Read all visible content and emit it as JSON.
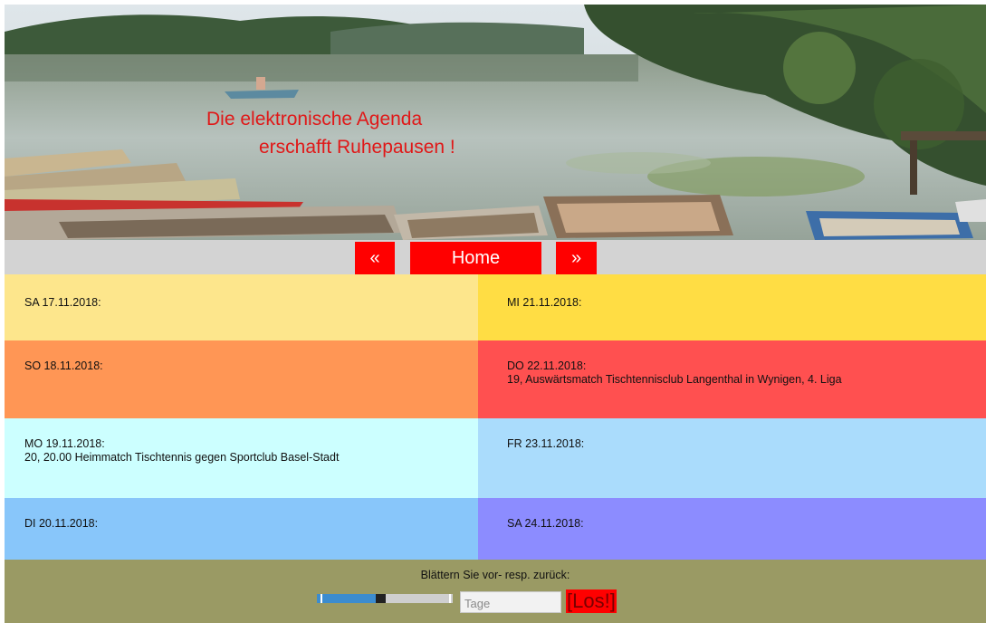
{
  "banner": {
    "slogan_line1": "Die elektronische Agenda",
    "slogan_line2": "erschafft Ruhepausen !"
  },
  "nav": {
    "prev_label": "«",
    "home_label": "Home",
    "next_label": "»"
  },
  "agenda": {
    "left": [
      {
        "date": "SA 17.11.2018:",
        "event": "",
        "color": "#fde68c"
      },
      {
        "date": "SO 18.11.2018:",
        "event": "",
        "color": "#ff9655"
      },
      {
        "date": "MO 19.11.2018:",
        "event": "20, 20.00 Heimmatch Tischtennis gegen Sportclub Basel-Stadt",
        "color": "#ccffff"
      },
      {
        "date": "DI 20.11.2018:",
        "event": "",
        "color": "#88c6fa"
      }
    ],
    "right": [
      {
        "date": "MI 21.11.2018:",
        "event": "",
        "color": "#ffdd44"
      },
      {
        "date": "DO 22.11.2018:",
        "event": "19, Auswärtsmatch Tischtennisclub Langenthal in Wynigen, 4. Liga",
        "color": "#ff5050"
      },
      {
        "date": "FR 23.11.2018:",
        "event": "",
        "color": "#aadcfc"
      },
      {
        "date": "SA 24.11.2018:",
        "event": "",
        "color": "#8c8cff"
      }
    ]
  },
  "footer": {
    "hint": "Blättern Sie vor- resp. zurück:",
    "slider_value": 0.47,
    "days_placeholder": "Tage",
    "submit_label": "[Los!]"
  },
  "colors": {
    "accent_red": "#ff0000",
    "nav_bg": "#d3d3d3",
    "footer_bg": "#9a9a64"
  }
}
